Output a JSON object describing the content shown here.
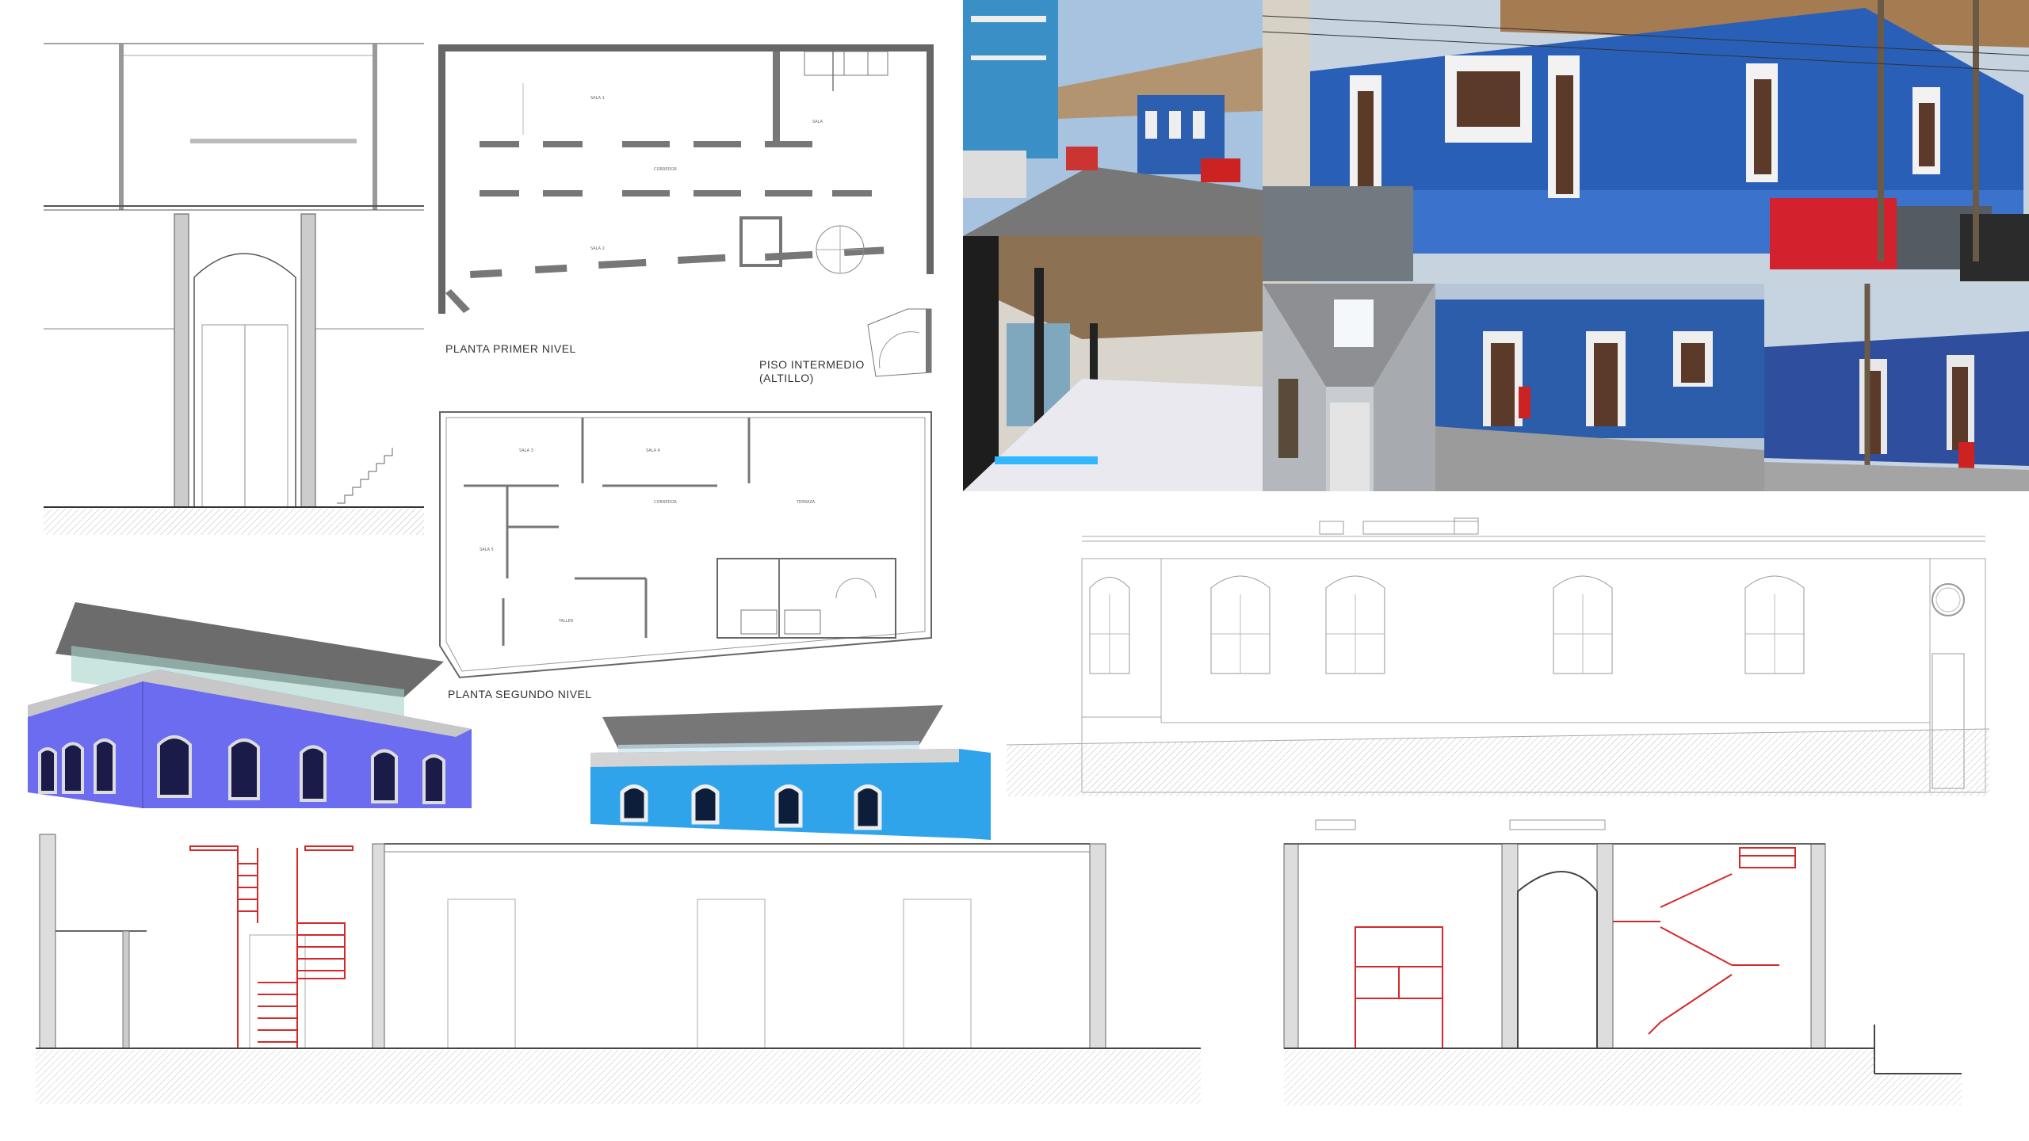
{
  "labels": {
    "plan_first": "PLANTA PRIMER NIVEL",
    "plan_mid_line1": "PISO INTERMEDIO",
    "plan_mid_line2": "(ALTILLO)",
    "plan_second": "PLANTA SEGUNDO NIVEL"
  },
  "colors": {
    "facade_blue": "#2a5fb8",
    "render_violet": "#6b6cf0",
    "render_cyan": "#2fa4ea",
    "stair_red": "#d62828",
    "wall_gray": "#666666",
    "ground_hatch": "#cfcfcf"
  }
}
